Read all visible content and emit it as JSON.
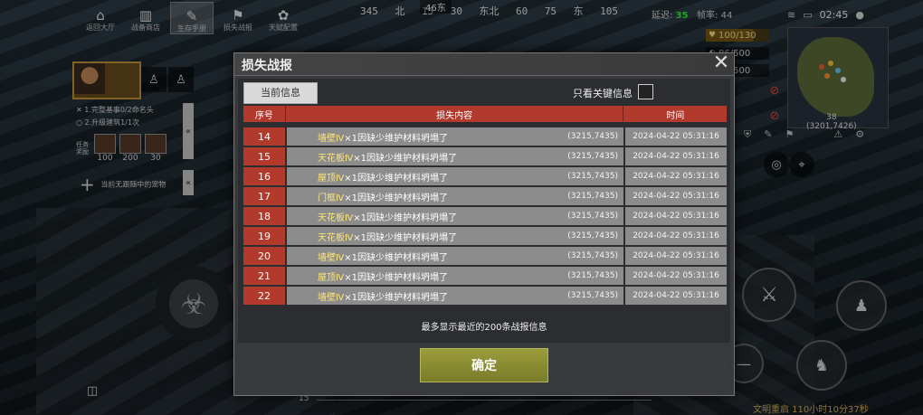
{
  "top_nav": [
    {
      "label": "返回大厅",
      "icon": "house-icon",
      "glyph": "⌂"
    },
    {
      "label": "战备商店",
      "icon": "shop-icon",
      "glyph": "▥"
    },
    {
      "label": "生存手册",
      "icon": "book-icon",
      "glyph": "✎"
    },
    {
      "label": "损失战报",
      "icon": "report-icon",
      "glyph": "⚑"
    },
    {
      "label": "天赋配置",
      "icon": "talent-icon",
      "glyph": "✿"
    }
  ],
  "compass": {
    "marks": [
      "345",
      "北",
      "15",
      "30",
      "东北",
      "60",
      "75",
      "东",
      "105"
    ],
    "marker": "46东"
  },
  "hud": {
    "latency_label": "延迟:",
    "latency": "35",
    "fps_label": "帧率:",
    "fps": "44",
    "time": "02:45"
  },
  "stats": {
    "hp": "100/130",
    "food": "86/500",
    "water": "79/500"
  },
  "minimap": {
    "region": "38",
    "coords": "(3201,7426)"
  },
  "tasks": {
    "line1": "1.完整基事0/2命名头",
    "line2": "2.升级建筑1/1次",
    "label": "任务奖励",
    "rewards": [
      "100",
      "200",
      "30"
    ],
    "follower": "当前无跟随中的宠物"
  },
  "bottom": {
    "compass_num": "15",
    "status_text": "文明重启 110小时10分37秒"
  },
  "dialog": {
    "title": "损失战报",
    "tab_current": "当前信息",
    "key_filter_label": "只看关键信息",
    "columns": {
      "no": "序号",
      "content": "损失内容",
      "time": "时间"
    },
    "rows": [
      {
        "no": "14",
        "item": "墙壁Ⅳ",
        "reason": "×1因缺少维护材料坍塌了",
        "coord": "(3215,7435)",
        "time": "2024-04-22 05:31:16"
      },
      {
        "no": "15",
        "item": "天花板Ⅳ",
        "reason": "×1因缺少维护材料坍塌了",
        "coord": "(3215,7435)",
        "time": "2024-04-22 05:31:16"
      },
      {
        "no": "16",
        "item": "屋顶Ⅳ",
        "reason": "×1因缺少维护材料坍塌了",
        "coord": "(3215,7435)",
        "time": "2024-04-22 05:31:16"
      },
      {
        "no": "17",
        "item": "门框Ⅳ",
        "reason": "×1因缺少维护材料坍塌了",
        "coord": "(3215,7435)",
        "time": "2024-04-22 05:31:16"
      },
      {
        "no": "18",
        "item": "天花板Ⅳ",
        "reason": "×1因缺少维护材料坍塌了",
        "coord": "(3215,7435)",
        "time": "2024-04-22 05:31:16"
      },
      {
        "no": "19",
        "item": "天花板Ⅳ",
        "reason": "×1因缺少维护材料坍塌了",
        "coord": "(3215,7435)",
        "time": "2024-04-22 05:31:16"
      },
      {
        "no": "20",
        "item": "墙壁Ⅳ",
        "reason": "×1因缺少维护材料坍塌了",
        "coord": "(3215,7435)",
        "time": "2024-04-22 05:31:16"
      },
      {
        "no": "21",
        "item": "屋顶Ⅳ",
        "reason": "×1因缺少维护材料坍塌了",
        "coord": "(3215,7435)",
        "time": "2024-04-22 05:31:16"
      },
      {
        "no": "22",
        "item": "墙壁Ⅳ",
        "reason": "×1因缺少维护材料坍塌了",
        "coord": "(3215,7435)",
        "time": "2024-04-22 05:31:16"
      }
    ],
    "max_note": "最多显示最近的200条战报信息",
    "confirm": "确定"
  }
}
